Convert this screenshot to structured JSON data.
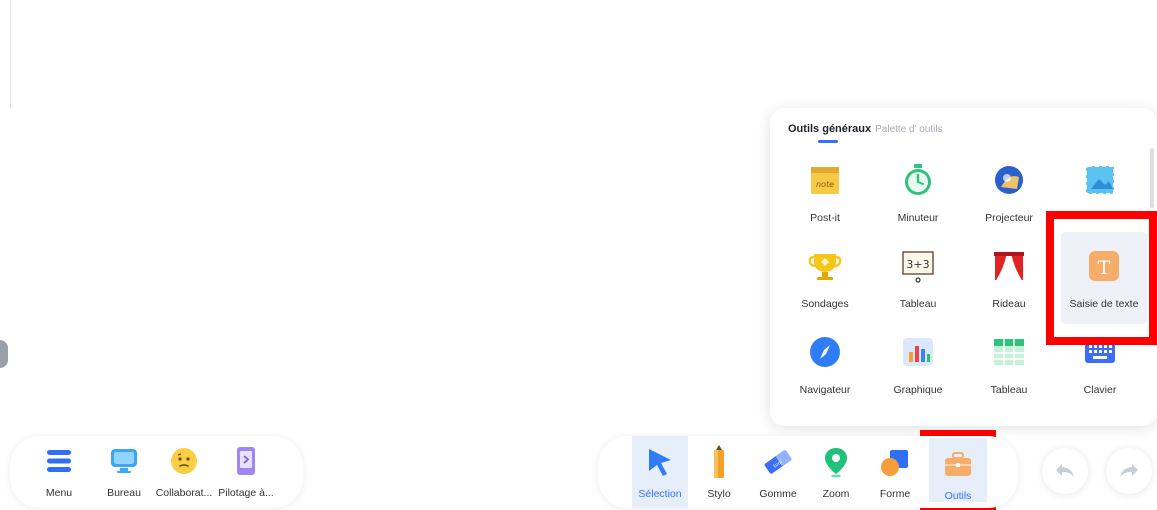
{
  "tools_panel": {
    "tabs": [
      {
        "label": "Outils généraux",
        "active": true
      },
      {
        "label": "Palette d' outils",
        "active": false
      }
    ],
    "tools": [
      {
        "label": "Post-it",
        "icon": "post-it-icon"
      },
      {
        "label": "Minuteur",
        "icon": "timer-icon"
      },
      {
        "label": "Projecteur",
        "icon": "spotlight-icon"
      },
      {
        "label": "",
        "icon": "screenshot-icon"
      },
      {
        "label": "Sondages",
        "icon": "trophy-icon"
      },
      {
        "label": "Tableau",
        "icon": "blackboard-icon"
      },
      {
        "label": "Rideau",
        "icon": "curtain-icon"
      },
      {
        "label": "Saisie de texte",
        "icon": "text-input-icon",
        "selected": true
      },
      {
        "label": "Navigateur",
        "icon": "compass-icon"
      },
      {
        "label": "Graphique",
        "icon": "chart-icon"
      },
      {
        "label": "Tableau",
        "icon": "table-icon"
      },
      {
        "label": "Clavier",
        "icon": "keyboard-icon"
      }
    ]
  },
  "left_toolbar": {
    "items": [
      {
        "label": "Menu",
        "icon": "menu-icon"
      },
      {
        "label": "Bureau",
        "icon": "desktop-icon"
      },
      {
        "label": "Collaborat...",
        "icon": "collaboration-emoji-icon"
      },
      {
        "label": "Pilotage à...",
        "icon": "phone-control-icon"
      }
    ]
  },
  "right_toolbar": {
    "items": [
      {
        "label": "Sélection",
        "icon": "cursor-icon",
        "active": true
      },
      {
        "label": "Stylo",
        "icon": "pen-icon"
      },
      {
        "label": "Gomme",
        "icon": "eraser-icon"
      },
      {
        "label": "Zoom",
        "icon": "zoom-pin-icon"
      },
      {
        "label": "Forme",
        "icon": "shape-icon"
      },
      {
        "label": "Outils",
        "icon": "toolbox-icon"
      }
    ]
  },
  "history": {
    "undo_icon": "undo-icon",
    "redo_icon": "redo-icon"
  },
  "colors": {
    "accent": "#3370ff",
    "highlight": "#ff0000",
    "active_bg": "#e6eef9"
  }
}
